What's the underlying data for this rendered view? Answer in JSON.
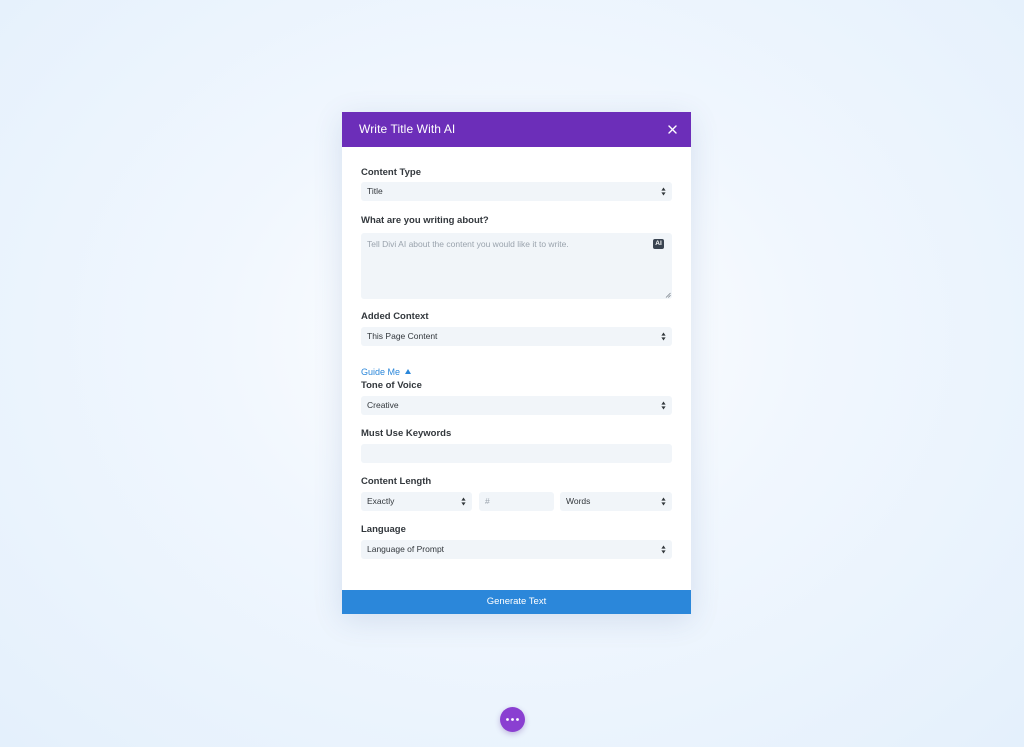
{
  "modal": {
    "title": "Write Title With AI",
    "close_icon": "close-icon",
    "header_color": "#6c2eb9"
  },
  "form": {
    "content_type": {
      "label": "Content Type",
      "value": "Title"
    },
    "writing_about": {
      "label": "What are you writing about?",
      "placeholder": "Tell Divi AI about the content you would like it to write.",
      "badge": "AI"
    },
    "added_context": {
      "label": "Added Context",
      "value": "This Page Content"
    },
    "guide_me": {
      "label": "Guide Me"
    },
    "tone_of_voice": {
      "label": "Tone of Voice",
      "value": "Creative"
    },
    "keywords": {
      "label": "Must Use Keywords",
      "value": ""
    },
    "content_length": {
      "label": "Content Length",
      "mode": "Exactly",
      "number_placeholder": "#",
      "unit": "Words"
    },
    "language": {
      "label": "Language",
      "value": "Language of Prompt"
    }
  },
  "actions": {
    "generate_label": "Generate Text",
    "button_color": "#2b87da"
  },
  "fab": {
    "icon": "more-dots-icon",
    "color": "#8a3fd1"
  }
}
